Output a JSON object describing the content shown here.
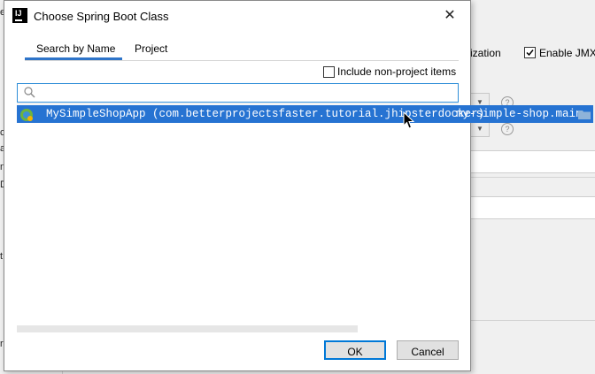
{
  "dialog": {
    "title": "Choose Spring Boot Class",
    "close_glyph": "✕",
    "app_icon_text": "IJ",
    "tabs": [
      {
        "label": "Search by Name",
        "active": true
      },
      {
        "label": "Project",
        "active": false
      }
    ],
    "include_non_project": {
      "label": "Include non-project items",
      "checked": false
    },
    "search": {
      "value": "",
      "placeholder": ""
    },
    "results": [
      {
        "class_text": "MySimpleShopApp (com.betterprojectsfaster.tutorial.jhipsterdocker)",
        "module": "my-simple-shop.main",
        "selected": true,
        "icon": "spring-boot-class-icon"
      }
    ],
    "buttons": {
      "ok": "OK",
      "cancel": "Cancel"
    }
  },
  "background": {
    "partial_label": "ization",
    "enable_jmx": {
      "label": "Enable JMX",
      "checked": true
    },
    "left_fragments": [
      "e",
      "c",
      "at",
      "n",
      "D",
      "t",
      "re"
    ]
  },
  "colors": {
    "selection": "#2673d2",
    "accent": "#2e74c9",
    "focus_border": "#2f8ed8"
  }
}
